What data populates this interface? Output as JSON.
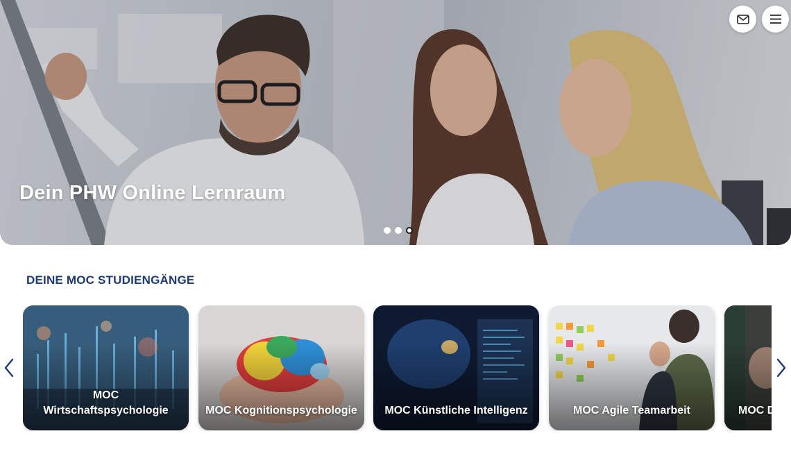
{
  "hero": {
    "title": "Dein PHW Online Lernraum",
    "slides": 3,
    "active_slide": 3,
    "mail_icon": "mail-icon",
    "menu_icon": "hamburger-menu-icon"
  },
  "section": {
    "title": "DEINE MOC STUDIENGÄNGE"
  },
  "cards": [
    {
      "line1": "MOC",
      "line2": "Wirtschaftspsychologie"
    },
    {
      "line1": "",
      "line2": "MOC Kognitionspsychologie"
    },
    {
      "line1": "",
      "line2": "MOC Künstliche Intelligenz"
    },
    {
      "line1": "",
      "line2": "MOC Agile Teamarbeit"
    },
    {
      "line1": "",
      "line2": "MOC D"
    }
  ],
  "colors": {
    "accent": "#1e3a73",
    "arrow": "#1e3a73"
  }
}
